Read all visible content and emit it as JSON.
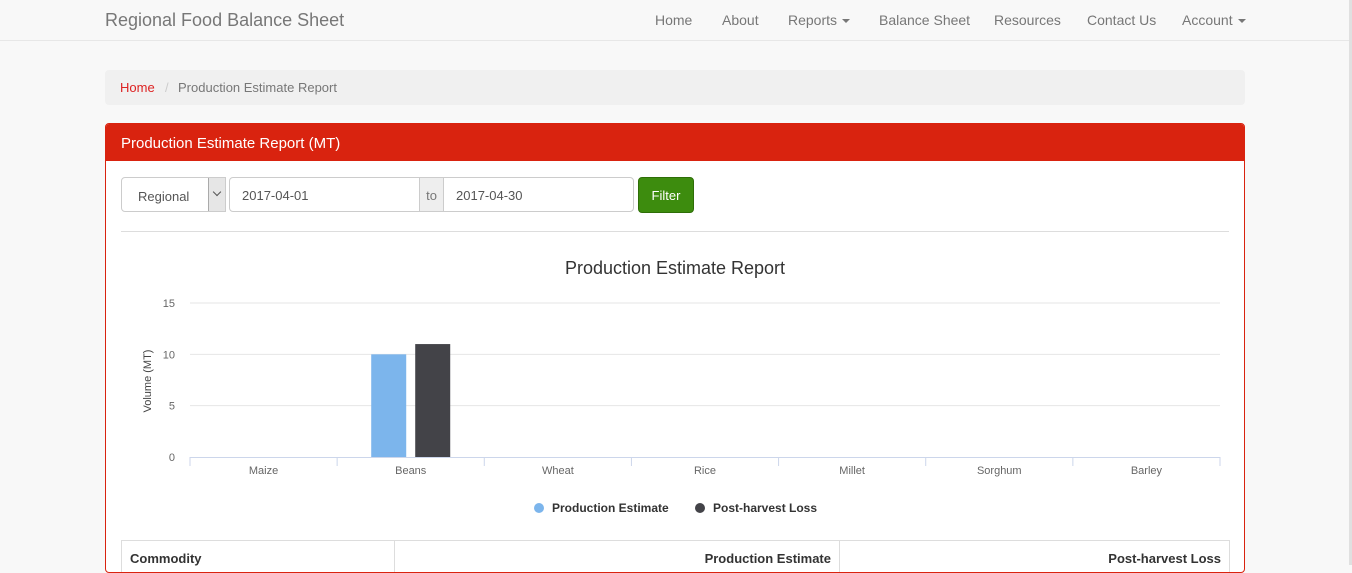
{
  "navbar": {
    "brand": "Regional Food Balance Sheet",
    "items": [
      {
        "label": "Home"
      },
      {
        "label": "About"
      },
      {
        "label": "Reports",
        "dropdown": true
      },
      {
        "label": "Balance Sheet"
      },
      {
        "label": "Resources"
      },
      {
        "label": "Contact Us"
      },
      {
        "label": "Account",
        "dropdown": true
      }
    ]
  },
  "breadcrumb": {
    "home": "Home",
    "separator": "/",
    "current": "Production Estimate Report"
  },
  "panel": {
    "title": "Production Estimate Report (MT)"
  },
  "filters": {
    "scope": "Regional",
    "date_from": "2017-04-01",
    "to_label": "to",
    "date_to": "2017-04-30",
    "filter_button": "Filter"
  },
  "chart_data": {
    "type": "bar",
    "title": "Production Estimate Report",
    "ylabel": "Volume (MT)",
    "xlabel": "",
    "ylim": [
      0,
      15
    ],
    "yticks": [
      0,
      5,
      10,
      15
    ],
    "grid": true,
    "legend_position": "bottom",
    "categories": [
      "Maize",
      "Beans",
      "Wheat",
      "Rice",
      "Millet",
      "Sorghum",
      "Barley"
    ],
    "series": [
      {
        "name": "Production Estimate",
        "color": "#7cb5ec",
        "values": [
          0,
          10,
          0,
          0,
          0,
          0,
          0
        ]
      },
      {
        "name": "Post-harvest Loss",
        "color": "#434348",
        "values": [
          0,
          11,
          0,
          0,
          0,
          0,
          0
        ]
      }
    ]
  },
  "table": {
    "headers": [
      "Commodity",
      "Production Estimate",
      "Post-harvest Loss"
    ]
  }
}
